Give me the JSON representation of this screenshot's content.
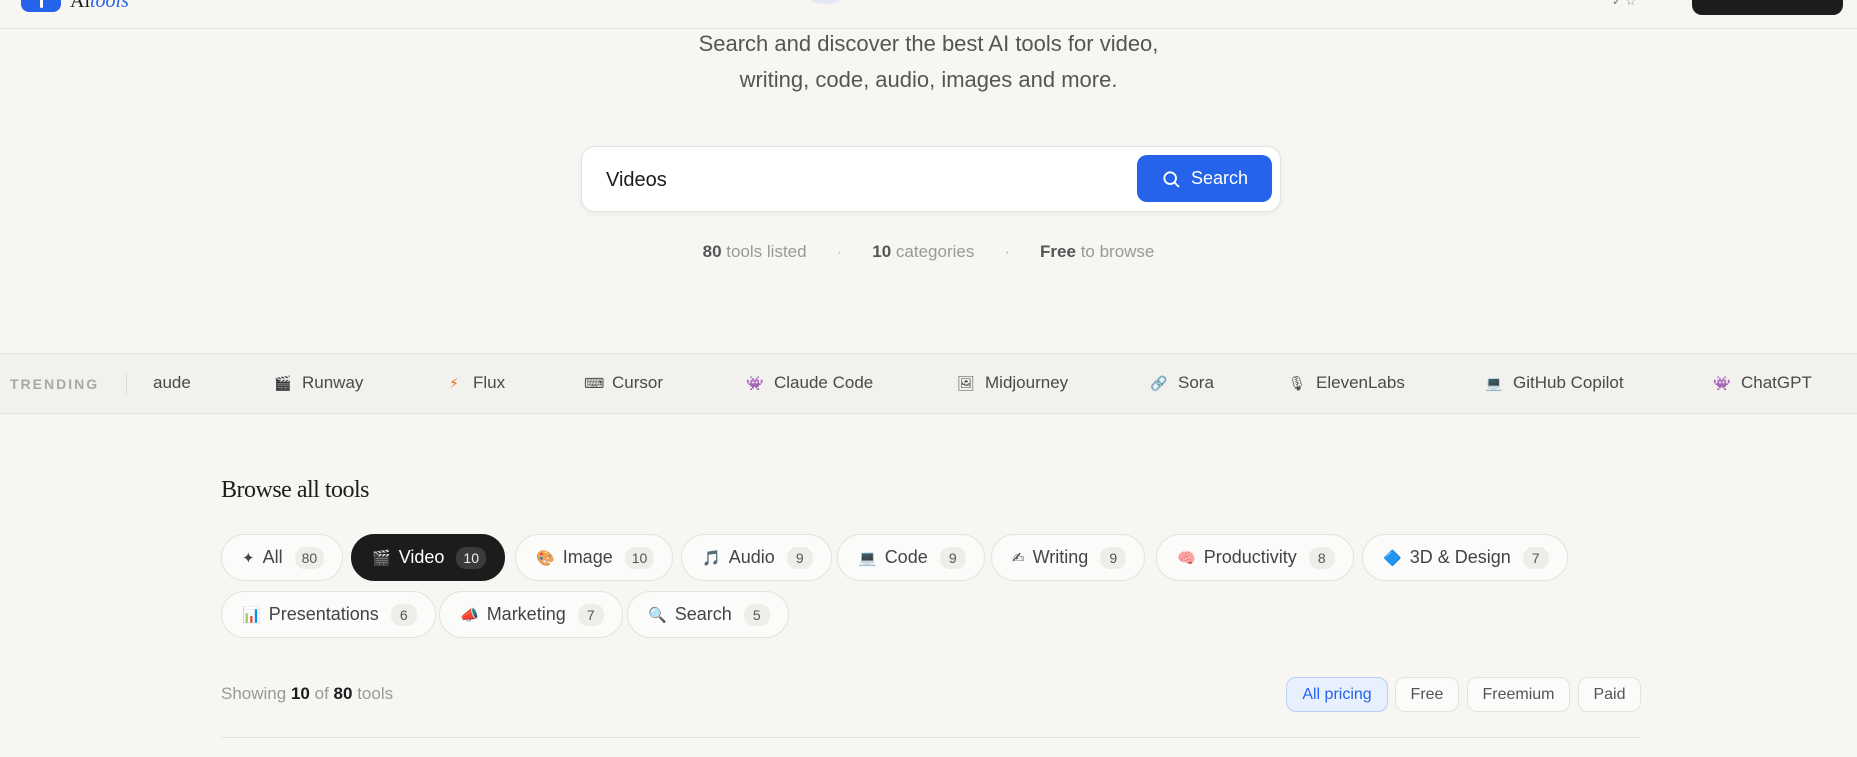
{
  "brand": {
    "logo_text_a": "Ai",
    "logo_text_b": "tools"
  },
  "hero": {
    "subtitle_line1": "Search and discover the best AI tools for video,",
    "subtitle_line2": "writing, code, audio, images and more."
  },
  "search": {
    "value": "Videos",
    "button_label": "Search",
    "icon": "search-icon"
  },
  "stats": [
    {
      "value": "80",
      "label": "tools listed"
    },
    {
      "value": "10",
      "label": "categories"
    },
    {
      "value": "Free",
      "label": "to browse"
    }
  ],
  "trending": {
    "label": "TRENDING",
    "items": [
      {
        "icon": "⬡",
        "label": "aude"
      },
      {
        "icon": "🎬",
        "label": "Runway"
      },
      {
        "icon": "⚡",
        "label": "Flux"
      },
      {
        "icon": "⌨",
        "label": "Cursor"
      },
      {
        "icon": "👾",
        "label": "Claude Code"
      },
      {
        "icon": "🖼",
        "label": "Midjourney"
      },
      {
        "icon": "🔗",
        "label": "Sora"
      },
      {
        "icon": "🎙",
        "label": "ElevenLabs"
      },
      {
        "icon": "💻",
        "label": "GitHub Copilot"
      },
      {
        "icon": "👾",
        "label": "ChatGPT"
      }
    ]
  },
  "browse": {
    "title": "Browse all tools",
    "categories": [
      {
        "icon": "✦",
        "label": "All",
        "count": "80",
        "active": false
      },
      {
        "icon": "🎬",
        "label": "Video",
        "count": "10",
        "active": true
      },
      {
        "icon": "🎨",
        "label": "Image",
        "count": "10",
        "active": false
      },
      {
        "icon": "🎵",
        "label": "Audio",
        "count": "9",
        "active": false
      },
      {
        "icon": "💻",
        "label": "Code",
        "count": "9",
        "active": false
      },
      {
        "icon": "✍",
        "label": "Writing",
        "count": "9",
        "active": false
      },
      {
        "icon": "🧠",
        "label": "Productivity",
        "count": "8",
        "active": false
      },
      {
        "icon": "🔷",
        "label": "3D & Design",
        "count": "7",
        "active": false
      },
      {
        "icon": "📊",
        "label": "Presentations",
        "count": "6",
        "active": false
      },
      {
        "icon": "📣",
        "label": "Marketing",
        "count": "7",
        "active": false
      },
      {
        "icon": "🔍",
        "label": "Search",
        "count": "5",
        "active": false
      }
    ],
    "showing": {
      "prefix": "Showing",
      "shown": "10",
      "of": "of",
      "total": "80",
      "suffix": "tools"
    },
    "pricing": [
      {
        "label": "All pricing",
        "active": true
      },
      {
        "label": "Free",
        "active": false
      },
      {
        "label": "Freemium",
        "active": false
      },
      {
        "label": "Paid",
        "active": false
      }
    ]
  },
  "colors": {
    "accent": "#2563eb",
    "dark": "#1c1c1c",
    "background": "#f7f6f3"
  }
}
